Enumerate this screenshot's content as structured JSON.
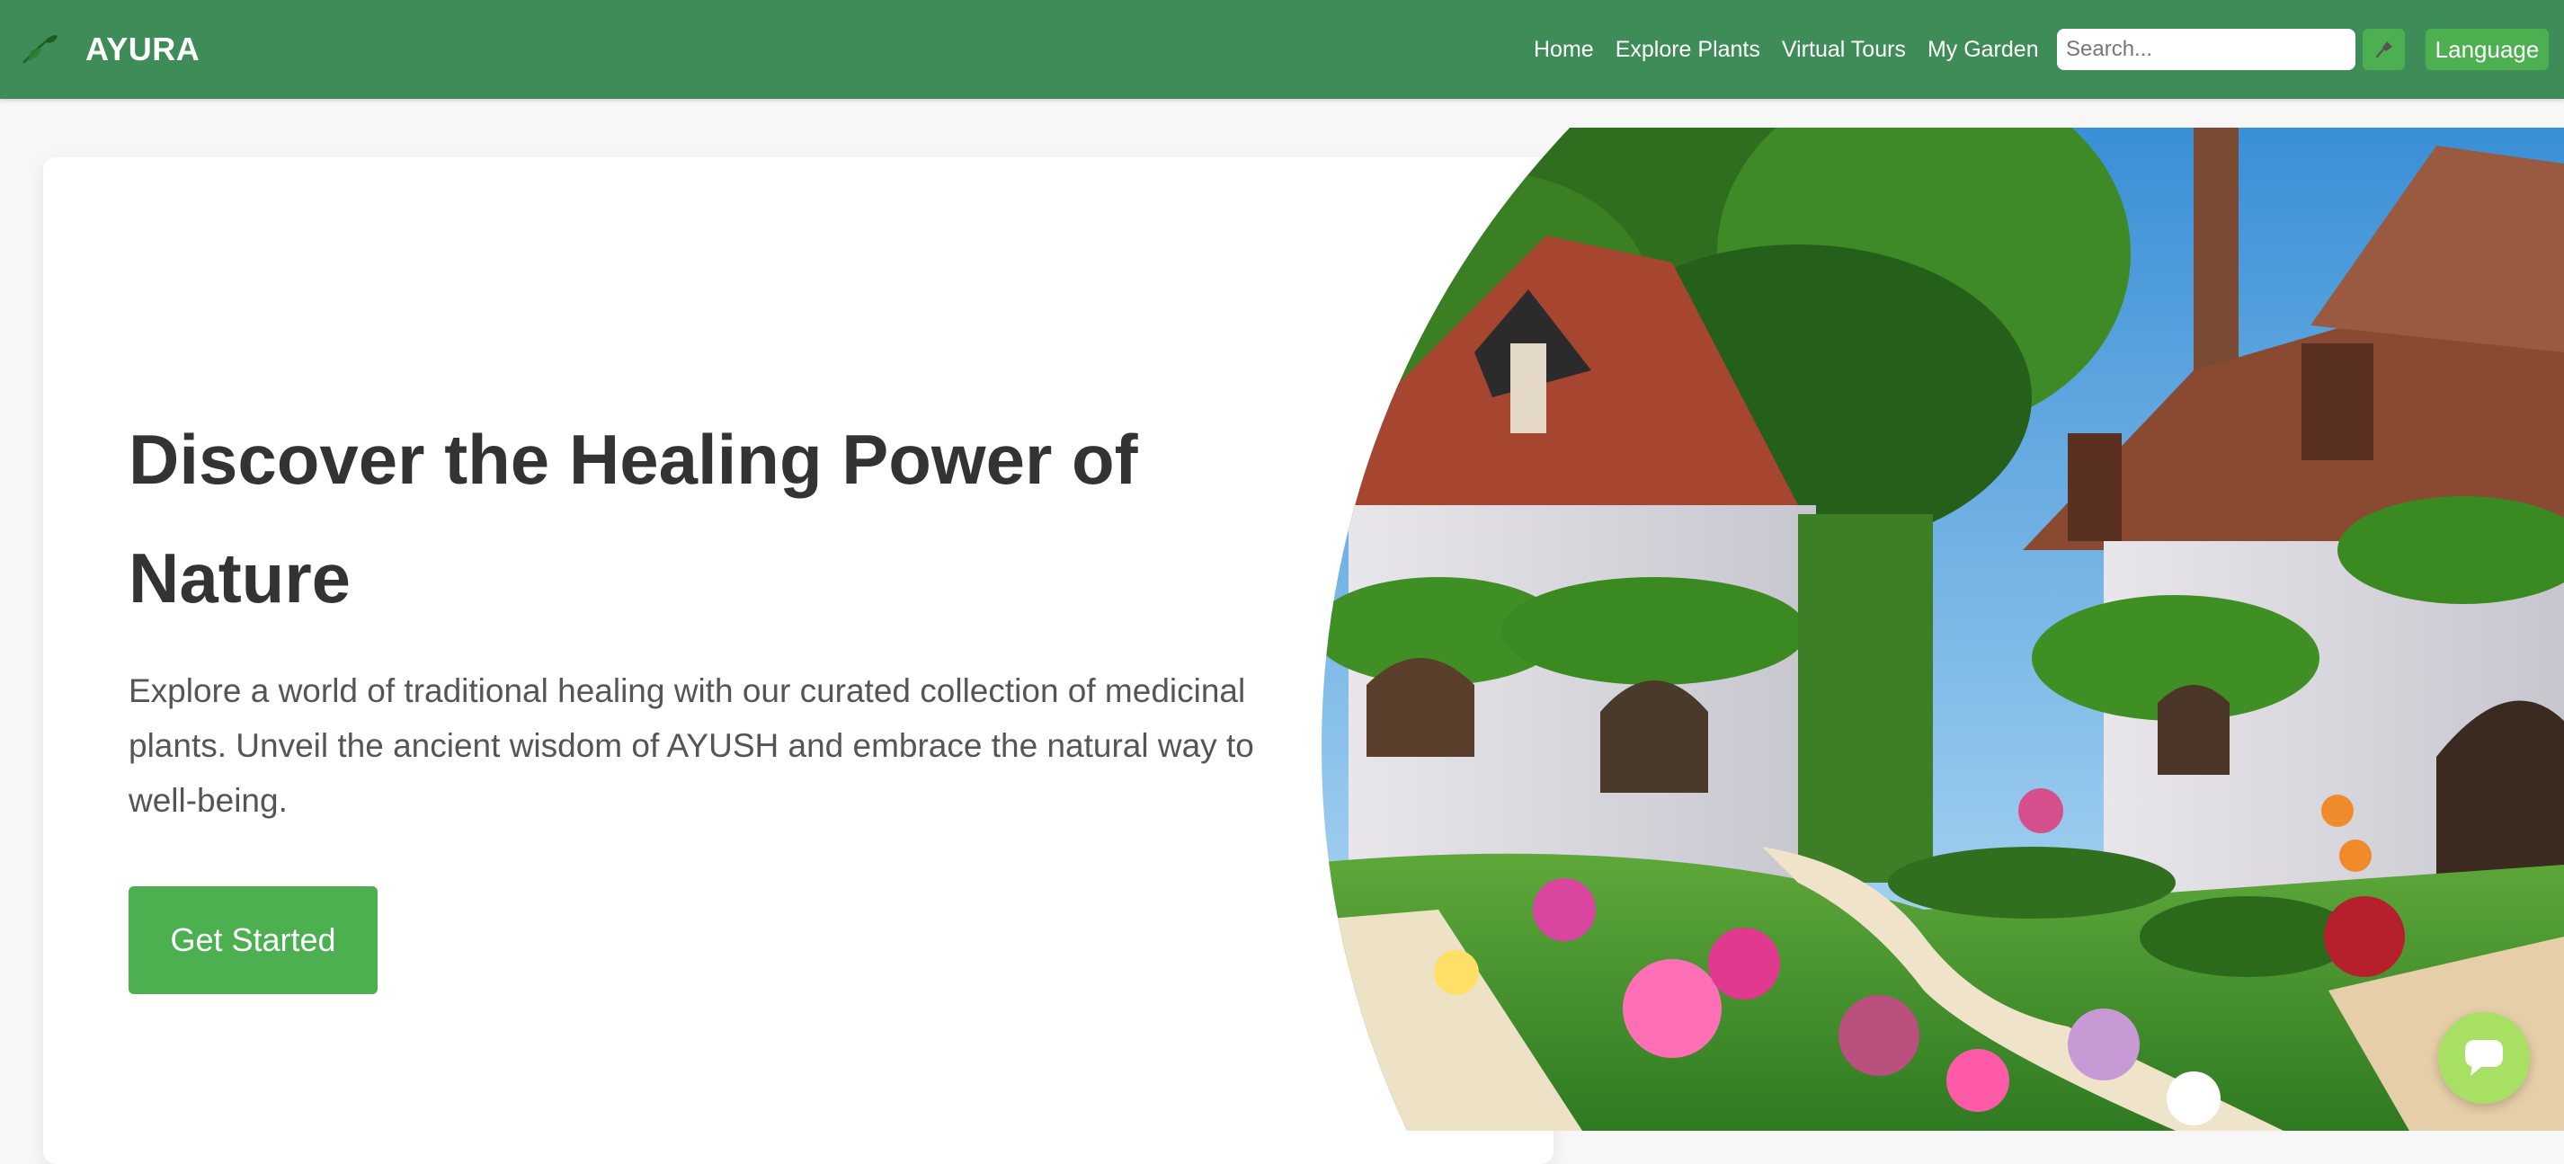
{
  "nav": {
    "brand": "AYURA",
    "links": [
      {
        "label": "Home"
      },
      {
        "label": "Explore Plants"
      },
      {
        "label": "Virtual Tours"
      },
      {
        "label": "My Garden"
      }
    ],
    "search": {
      "placeholder": "Search...",
      "value": ""
    },
    "mic_icon": "microphone-icon",
    "language_label": "Language"
  },
  "hero": {
    "title": "Discover the Healing Power of Nature",
    "description": "Explore a world of traditional healing with our curated collection of medicinal plants. Unveil the ancient wisdom of AYUSH and embrace the natural way to well-being.",
    "cta_label": "Get Started"
  },
  "chat": {
    "icon": "chat-bubble-icon"
  },
  "colors": {
    "navbar": "#3e8c57",
    "accent": "#4caf50",
    "chat_button": "#a8e063",
    "heading": "#333333",
    "body_text": "#555555"
  }
}
